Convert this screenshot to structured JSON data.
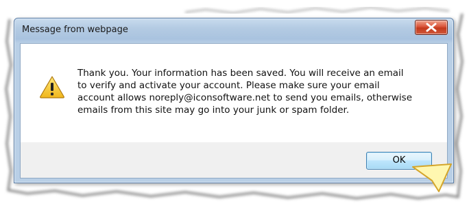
{
  "dialog": {
    "title": "Message from webpage",
    "message": "Thank you.  Your information has been saved.  You will receive an email\nto verify and activate your account. Please make sure your email\naccount allows noreply@iconsoftware.net to send you emails, otherwise\nemails from this site may go into your junk or spam folder.",
    "ok_label": "OK"
  },
  "icons": {
    "warning": "warning-icon",
    "close": "close-icon",
    "pointer": "cursor-arrow-icon"
  },
  "colors": {
    "title_bar": "#b4cbe3",
    "close_button": "#c33a1c",
    "ok_button": "#bee6fd",
    "warning_yellow": "#f6c62c",
    "cursor_yellow": "#fff7b0"
  }
}
